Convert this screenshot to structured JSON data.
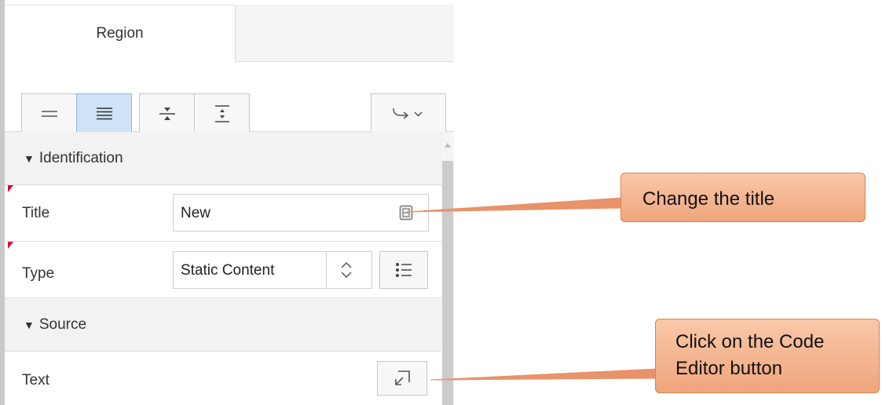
{
  "tabs": {
    "region_label": "Region"
  },
  "toolbar": {
    "buttons": [
      {
        "name": "compact-view",
        "icon": "lines-icon",
        "active": false
      },
      {
        "name": "expanded-view",
        "icon": "list-lines-icon",
        "active": true
      },
      {
        "name": "collapse-all",
        "icon": "collapse-icon",
        "active": false
      },
      {
        "name": "expand-all",
        "icon": "expand-icon",
        "active": false
      },
      {
        "name": "go-to-group",
        "icon": "arrow-hook-dropdown-icon",
        "active": false
      }
    ]
  },
  "sections": {
    "identification": "Identification",
    "source": "Source"
  },
  "fields": {
    "title": {
      "label": "Title",
      "value": "New"
    },
    "type": {
      "label": "Type",
      "value": "Static Content"
    },
    "text": {
      "label": "Text"
    }
  },
  "callouts": {
    "title": "Change the title",
    "code_editor_line1": "Click on the Code",
    "code_editor_line2": "Editor button"
  },
  "colors": {
    "active_button": "#cfe3f8",
    "required_marker": "#e0003a",
    "callout_fill": "#f4b08a",
    "callout_line": "#e8936a"
  }
}
